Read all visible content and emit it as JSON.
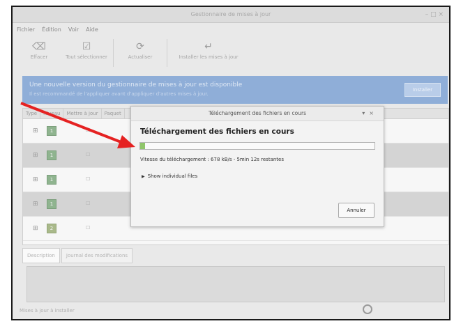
{
  "window": {
    "title": "Gestionnaire de mises à jour",
    "controls": "– □ ×"
  },
  "menubar": {
    "items": [
      "Fichier",
      "Édition",
      "Voir",
      "Aide"
    ]
  },
  "toolbar": {
    "buttons": [
      {
        "label": "Effacer",
        "icon": "clear-icon"
      },
      {
        "label": "Tout sélectionner",
        "icon": "select-all-icon"
      },
      {
        "label": "Actualiser",
        "icon": "refresh-icon"
      },
      {
        "label": "Installer les mises à jour",
        "icon": "install-icon"
      }
    ]
  },
  "banner": {
    "line1": "Une nouvelle version du gestionnaire de mises à jour est disponible",
    "line2": "Il est recommandé de l'appliquer avant d'appliquer d'autres mises à jour.",
    "button": "Installer"
  },
  "table": {
    "headers": [
      "Type",
      "Niveau",
      "Mettre à jour",
      "Paquet"
    ],
    "rows": [
      {
        "level": "1",
        "alt": false
      },
      {
        "level": "1",
        "alt": true
      },
      {
        "level": "1",
        "alt": false
      },
      {
        "level": "1",
        "alt": true
      },
      {
        "level": "2",
        "alt": false
      }
    ]
  },
  "bottom_tabs": [
    "Description",
    "Journal des modifications"
  ],
  "statusbar": {
    "text": "Mises à jour à installer"
  },
  "dialog": {
    "title": "Téléchargement des fichiers en cours",
    "heading": "Téléchargement des fichiers en cours",
    "progress": 0.02,
    "speed": "Vitesse du téléchargement : 678 kB/s - 5min 12s restantes",
    "details_toggle": "Show individual files",
    "cancel": "Annuler"
  },
  "colors": {
    "accent_banner": "#8faed8",
    "progress": "#8fc56a",
    "annotation_arrow": "#e52222"
  }
}
